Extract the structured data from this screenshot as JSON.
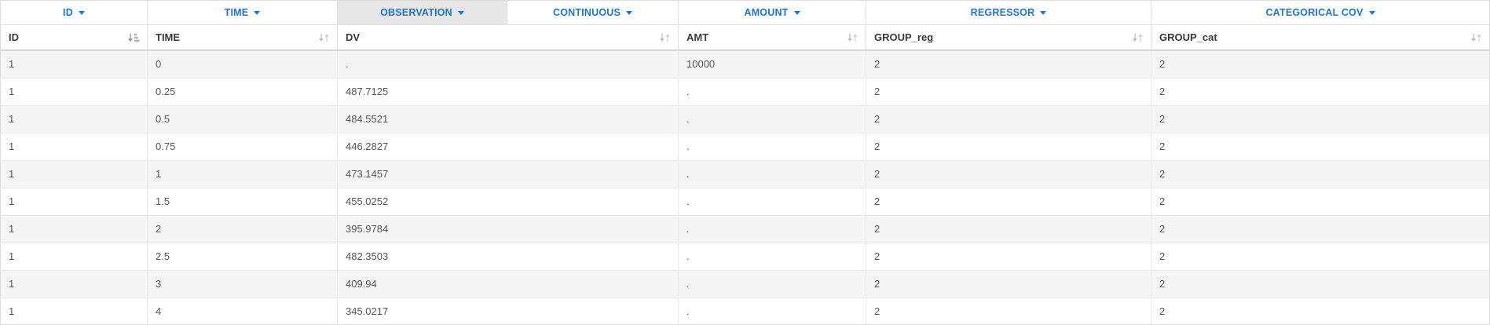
{
  "selectors": [
    {
      "label": "ID",
      "active": false
    },
    {
      "label": "TIME",
      "active": false
    },
    {
      "label": "OBSERVATION",
      "active": true
    },
    {
      "label": "CONTINUOUS",
      "active": false
    },
    {
      "label": "AMOUNT",
      "active": false
    },
    {
      "label": "REGRESSOR",
      "active": false
    },
    {
      "label": "CATEGORICAL COV",
      "active": false
    }
  ],
  "columns": [
    {
      "label": "ID",
      "sort_state": "sorted"
    },
    {
      "label": "TIME",
      "sort_state": "unsorted"
    },
    {
      "label": "DV",
      "sort_state": "unsorted"
    },
    {
      "label": "AMT",
      "sort_state": "unsorted"
    },
    {
      "label": "GROUP_reg",
      "sort_state": "unsorted"
    },
    {
      "label": "GROUP_cat",
      "sort_state": "unsorted"
    }
  ],
  "rows": [
    [
      "1",
      "0",
      ".",
      "10000",
      "2",
      "2"
    ],
    [
      "1",
      "0.25",
      "487.7125",
      ".",
      "2",
      "2"
    ],
    [
      "1",
      "0.5",
      "484.5521",
      ".",
      "2",
      "2"
    ],
    [
      "1",
      "0.75",
      "446.2827",
      ".",
      "2",
      "2"
    ],
    [
      "1",
      "1",
      "473.1457",
      ".",
      "2",
      "2"
    ],
    [
      "1",
      "1.5",
      "455.0252",
      ".",
      "2",
      "2"
    ],
    [
      "1",
      "2",
      "395.9784",
      ".",
      "2",
      "2"
    ],
    [
      "1",
      "2.5",
      "482.3503",
      ".",
      "2",
      "2"
    ],
    [
      "1",
      "3",
      "409.94",
      ".",
      "2",
      "2"
    ],
    [
      "1",
      "4",
      "345.0217",
      ".",
      "2",
      "2"
    ]
  ],
  "icons": {
    "selector_caret": "caret-down",
    "sorted_column": "sort-amount-down",
    "unsorted_column": "sort-up-down"
  },
  "colors": {
    "accent_blue": "#1976d2",
    "active_selector_bg": "#e7e7e7",
    "stripe_row_bg": "#f5f5f5",
    "border": "#e0e0e0",
    "header_text": "#3a3a3a",
    "data_text": "#555555",
    "sort_icon_active": "#8f8f8f",
    "sort_icon_inactive": "#c6c6c6"
  }
}
